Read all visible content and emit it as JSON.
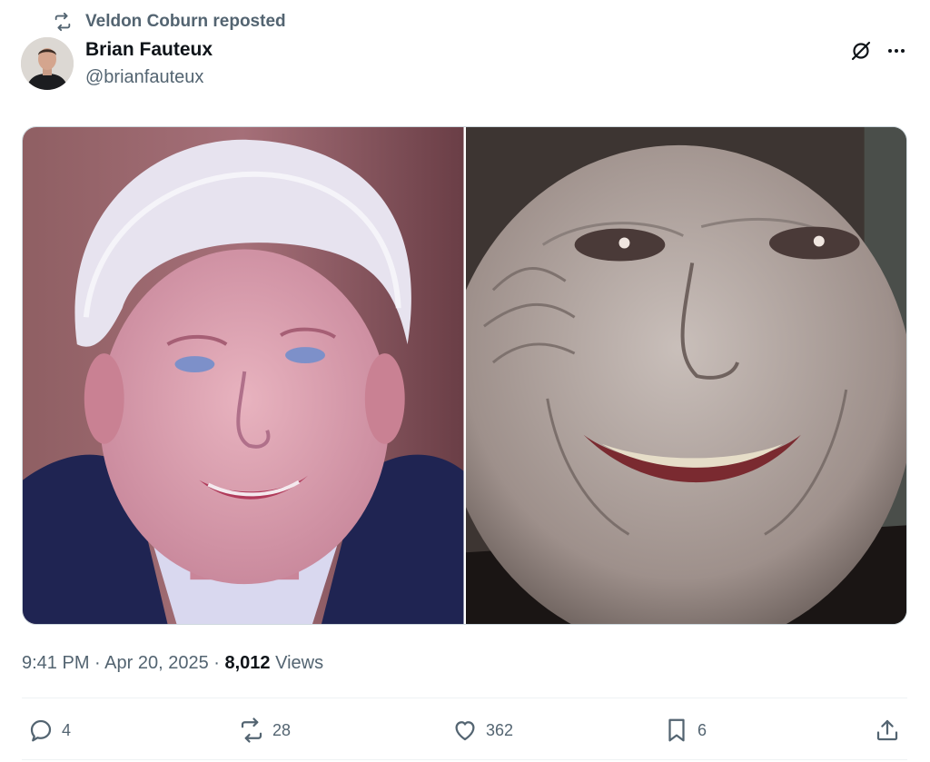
{
  "repost": {
    "icon": "repost-icon",
    "text": "Veldon Coburn reposted"
  },
  "author": {
    "name": "Brian Fauteux",
    "handle": "@brianfauteux",
    "avatar_icon": "avatar"
  },
  "header_actions": {
    "grok_icon": "grok-icon",
    "more_icon": "more-options-icon"
  },
  "media": {
    "photos": [
      {
        "name": "photo-left",
        "description_icon": "photo"
      },
      {
        "name": "photo-right",
        "description_icon": "photo"
      }
    ]
  },
  "meta": {
    "time": "9:41 PM",
    "separator": " · ",
    "date": "Apr 20, 2025",
    "views_count": "8,012",
    "views_label": "Views"
  },
  "actions": {
    "reply_count": "4",
    "repost_count": "28",
    "like_count": "362",
    "bookmark_count": "6"
  },
  "colors": {
    "secondary_text": "#536471",
    "primary_text": "#0f1419",
    "divider": "#eff3f4"
  }
}
